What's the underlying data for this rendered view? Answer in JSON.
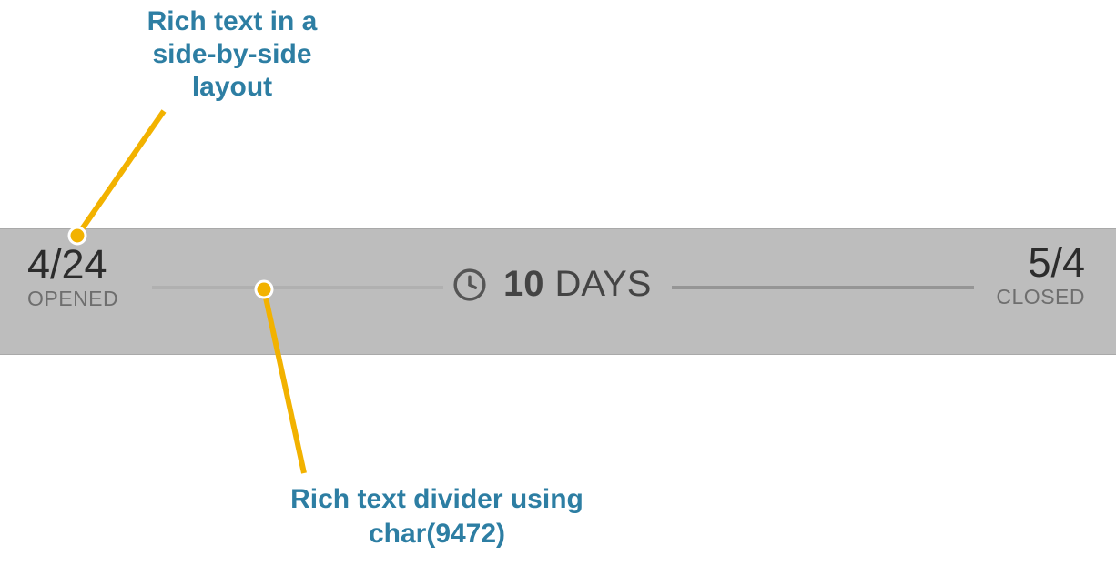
{
  "annotations": {
    "top": "Rich text in a side-by-side layout",
    "bottom": "Rich text divider using char(9472)"
  },
  "timeline": {
    "opened": {
      "date": "4/24",
      "label": "OPENED"
    },
    "closed": {
      "date": "5/4",
      "label": "CLOSED"
    },
    "duration": {
      "count": "10",
      "unit": "DAYS"
    }
  }
}
